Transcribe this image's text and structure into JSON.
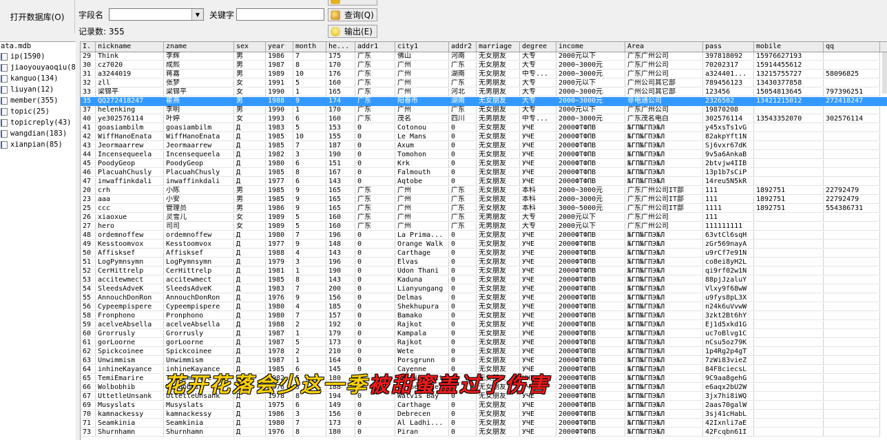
{
  "toolbar": {
    "open_db_label": "打开数据库(O)",
    "field_label": "字段名",
    "field_value": "",
    "keyword_label": "关键字",
    "keyword_value": "",
    "record_count_label": "记录数: 355",
    "query_label": "查询(Q)",
    "export_label": "输出(E)"
  },
  "tree": {
    "root": "ata.mdb",
    "items": [
      "ip(1590)",
      "jiaoyouyaoqiu(8)",
      "kanguo(134)",
      "liuyan(12)",
      "member(355)",
      "topic(25)",
      "topicreply(43)",
      "wangdian(183)",
      "xianpian(85)"
    ]
  },
  "grid": {
    "columns": [
      "I.",
      "nickname",
      "zname",
      "sex",
      "year",
      "month",
      "he...",
      "addr1",
      "city1",
      "addr2",
      "marriage",
      "degree",
      "income",
      "Area",
      "pass",
      "mobile",
      "qq"
    ],
    "selected_row": 6,
    "rows": [
      [
        "29",
        "Think",
        "李辉",
        "男",
        "1986",
        "7",
        "175",
        "广东",
        "佛山",
        "河南",
        "无女朋友",
        "大专",
        "2000元以下",
        "广东广州公司",
        "397818092",
        "15976627193",
        ""
      ],
      [
        "30",
        "cz7020",
        "成熙",
        "男",
        "1987",
        "8",
        "170",
        "广东",
        "广州",
        "广东",
        "无女朋友",
        "大专",
        "2000~3000元",
        "广东广州公司",
        "70202317",
        "15914455612",
        ""
      ],
      [
        "31",
        "a3244019",
        "蒋嘉",
        "男",
        "1989",
        "10",
        "176",
        "广东",
        "广州",
        "湖南",
        "无女朋友",
        "中专...",
        "2000~3000元",
        "广东广州公司",
        "a324401...",
        "13215755727",
        "58096825"
      ],
      [
        "32",
        "zll",
        "张梦",
        "女",
        "1991",
        "5",
        "160",
        "广东",
        "广州",
        "广东",
        "无男朋友",
        "大专",
        "2000元以下",
        "广州公司其它部",
        "789456123",
        "13430377858",
        ""
      ],
      [
        "33",
        "梁锦平",
        "梁锦平",
        "女",
        "1990",
        "1",
        "165",
        "广东",
        "广州",
        "河北",
        "无男朋友",
        "大专",
        "2000~3000元",
        "广州公司其它部",
        "123456",
        "15054813645",
        "797396251"
      ],
      [
        "35",
        "QQ272418247",
        "瞿燕",
        "男",
        "1988",
        "9",
        "174",
        "广东",
        "阳春市",
        "湖南",
        "无女朋友",
        "大专",
        "2000~3000元",
        "非电通公司",
        "2326502",
        "13421215012",
        "272418247"
      ],
      [
        "37",
        "helenking",
        "李明",
        "男",
        "1990",
        "1",
        "170",
        "广东",
        "广州",
        "广东",
        "无女朋友",
        "大专",
        "2000元以下",
        "广东广州公司",
        "19870208",
        "",
        ""
      ],
      [
        "40",
        "ye302576114",
        "叶婷",
        "女",
        "1993",
        "6",
        "160",
        "广东",
        "茂名",
        "四川",
        "无男朋友",
        "中专...",
        "2000~3000元",
        "广东茂名电白",
        "302576114",
        "13543352070",
        "302576114"
      ],
      [
        "41",
        "goasiambilm",
        "goasiambilm",
        "Д",
        "1983",
        "5",
        "153",
        "0",
        "Cotonou",
        "0",
        "无女朋友",
        "УЧЁ",
        "2000ФТФПВ",
        "№ГП№ГПЭ№Л",
        "y45xsTs1vG",
        "",
        ""
      ],
      [
        "42",
        "WiffHanoEnata",
        "WiffHanoEnata",
        "Д",
        "1985",
        "10",
        "155",
        "0",
        "Le Mans",
        "0",
        "无女朋友",
        "УЧЁ",
        "2000ФТФПВ",
        "№ГП№ГПЭ№Л",
        "82akpYft1N",
        "",
        ""
      ],
      [
        "43",
        "Jeormaarrew",
        "Jeormaarrew",
        "Д",
        "1985",
        "7",
        "187",
        "0",
        "Axum",
        "0",
        "无女朋友",
        "УЧЁ",
        "2000ФТФПВ",
        "№ГП№ГПЭ№Л",
        "Sj6vxr67dK",
        "",
        ""
      ],
      [
        "44",
        "Incensequeela",
        "Incensequeela",
        "Д",
        "1982",
        "3",
        "190",
        "0",
        "Tomohon",
        "0",
        "无女朋友",
        "УЧЁ",
        "2000ФТФПВ",
        "№ГП№ГПЭ№Л",
        "9v5a6AnkaB",
        "",
        ""
      ],
      [
        "45",
        "PoodyGeop",
        "PoodyGeop",
        "Д",
        "1980",
        "6",
        "151",
        "0",
        "Krk",
        "0",
        "无女朋友",
        "УЧЁ",
        "2000ФТФПВ",
        "№ГП№ГПЭ№Л",
        "2btvjw4IIB",
        "",
        ""
      ],
      [
        "46",
        "PlacuahChusly",
        "PlacuahChusly",
        "Д",
        "1985",
        "8",
        "167",
        "0",
        "Falmouth",
        "0",
        "无女朋友",
        "УЧЁ",
        "2000ФТФПВ",
        "№ГП№ГПЭ№Л",
        "13p1b7sCiP",
        "",
        ""
      ],
      [
        "47",
        "inwaffinkdali",
        "inwaffinkdali",
        "Д",
        "1977",
        "6",
        "143",
        "0",
        "Aqtobe",
        "0",
        "无女朋友",
        "УЧЁ",
        "2000ФТФПВ",
        "№ГП№ГПЭ№Л",
        "14reu5N5kR",
        "",
        ""
      ],
      [
        "20",
        "crh",
        "小陈",
        "男",
        "1985",
        "9",
        "165",
        "广东",
        "广州",
        "广东",
        "无女朋友",
        "本科",
        "2000~3000元",
        "广东广州公司IT部",
        "111",
        "1892751",
        "22792479"
      ],
      [
        "23",
        "aaa",
        "小安",
        "男",
        "1985",
        "9",
        "165",
        "广东",
        "广州",
        "广东",
        "无女朋友",
        "本科",
        "2000~3000元",
        "广东广州公司IT部",
        "111",
        "1892751",
        "22792479"
      ],
      [
        "25",
        "ccc",
        "管理员",
        "男",
        "1986",
        "9",
        "165",
        "广东",
        "广州",
        "广东",
        "无女朋友",
        "本科",
        "3000~5000元",
        "广东广州公司IT部",
        "1111",
        "1892751",
        "554386731"
      ],
      [
        "26",
        "xiaoxue",
        "灵雪儿",
        "女",
        "1989",
        "5",
        "160",
        "广东",
        "广州",
        "广东",
        "无男朋友",
        "大专",
        "2000元以下",
        "广东广州公司",
        "111",
        "",
        ""
      ],
      [
        "27",
        "hero",
        "司司",
        "女",
        "1989",
        "5",
        "160",
        "广东",
        "广州",
        "广东",
        "无男朋友",
        "大专",
        "2000元以下",
        "广东广州公司",
        "111111111",
        "",
        ""
      ],
      [
        "48",
        "ordemnoffew",
        "ordemnoffew",
        "Д",
        "1980",
        "7",
        "196",
        "0",
        "La Prima...",
        "0",
        "无女朋友",
        "УЧЁ",
        "2000ФТФПВ",
        "№ГП№ГПЭ№Л",
        "63vtCl6sqH",
        "",
        ""
      ],
      [
        "49",
        "Kesstoomvox",
        "Kesstoomvox",
        "Д",
        "1977",
        "9",
        "148",
        "0",
        "Orange Walk",
        "0",
        "无女朋友",
        "УЧЁ",
        "2000ФТФПВ",
        "№ГП№ГПЭ№Л",
        "zGr569nayA",
        "",
        ""
      ],
      [
        "50",
        "Affisksef",
        "Affisksef",
        "Д",
        "1988",
        "4",
        "143",
        "0",
        "Carthage",
        "0",
        "无女朋友",
        "УЧЁ",
        "2000ФТФПВ",
        "№ГП№ГПЭ№Л",
        "u9rCf7e91N",
        "",
        ""
      ],
      [
        "51",
        "LogPymnsymn",
        "LogPymnsymn",
        "Д",
        "1979",
        "3",
        "196",
        "0",
        "Elvas",
        "0",
        "无女朋友",
        "УЧЁ",
        "2000ФТФПВ",
        "№ГП№ГПЭ№Л",
        "co8ei8yH2L",
        "",
        ""
      ],
      [
        "52",
        "CerHittrelp",
        "CerHittrelp",
        "Д",
        "1981",
        "1",
        "190",
        "0",
        "Udon Thani",
        "0",
        "无女朋友",
        "УЧЁ",
        "2000ФТФПВ",
        "№ГП№ГПЭ№Л",
        "qi9rf02w1N",
        "",
        ""
      ],
      [
        "53",
        "accitewmect",
        "accitewmect",
        "Д",
        "1985",
        "8",
        "143",
        "0",
        "Kaduna",
        "0",
        "无女朋友",
        "УЧЁ",
        "2000ФТФПВ",
        "№ГП№ГПЭ№Л",
        "88pjJzaluY",
        "",
        ""
      ],
      [
        "54",
        "SleedsAdveK",
        "SleedsAdveK",
        "Д",
        "1983",
        "7",
        "200",
        "0",
        "Lianyungang",
        "0",
        "无女朋友",
        "УЧЁ",
        "2000ФТФПВ",
        "№ГП№ГПЭ№Л",
        "Vlxy9f68wW",
        "",
        ""
      ],
      [
        "55",
        "AnnouchDonRon",
        "AnnouchDonRon",
        "Д",
        "1976",
        "9",
        "156",
        "0",
        "Delmas",
        "0",
        "无女朋友",
        "УЧЁ",
        "2000ФТФПВ",
        "№ГП№ГПЭ№Л",
        "u9fys8pL3X",
        "",
        ""
      ],
      [
        "56",
        "Cypeempispere",
        "Cypeempispere",
        "Д",
        "1980",
        "4",
        "185",
        "0",
        "Shekhupura",
        "0",
        "无女朋友",
        "УЧЁ",
        "2000ФТФПВ",
        "№ГП№ГПЭ№Л",
        "n24k6uVvwW",
        "",
        ""
      ],
      [
        "58",
        "Fronphono",
        "Pronphono",
        "Д",
        "1980",
        "7",
        "157",
        "0",
        "Bamako",
        "0",
        "无女朋友",
        "УЧЁ",
        "2000ФТФПВ",
        "№ГП№ГПЭ№Л",
        "3zkt2Bt6hY",
        "",
        ""
      ],
      [
        "59",
        "acelveAbsella",
        "acelveAbsella",
        "Д",
        "1988",
        "2",
        "192",
        "0",
        "Rajkot",
        "0",
        "无女朋友",
        "УЧЁ",
        "2000ФТФПВ",
        "№ГП№ГПЭ№Л",
        "Ej1d5xkd1G",
        "",
        ""
      ],
      [
        "60",
        "Grorrusly",
        "Grorrusly",
        "Д",
        "1987",
        "1",
        "179",
        "0",
        "Kampala",
        "0",
        "无女朋友",
        "УЧЁ",
        "2000ФТФПВ",
        "№ГП№ГПЭ№Л",
        "uc7oBlvg1C",
        "",
        ""
      ],
      [
        "61",
        "gorLoorne",
        "gorLoorne",
        "Д",
        "1987",
        "5",
        "173",
        "0",
        "Rajkot",
        "0",
        "无女朋友",
        "УЧЁ",
        "2000ФТФПВ",
        "№ГП№ГПЭ№Л",
        "nCsu5oz79K",
        "",
        ""
      ],
      [
        "62",
        "Spickcoinee",
        "Spickcoinee",
        "Д",
        "1978",
        "2",
        "210",
        "0",
        "Wete",
        "0",
        "无女朋友",
        "УЧЁ",
        "2000ФТФПВ",
        "№ГП№ГПЭ№Л",
        "1p4Rg2p4gT",
        "",
        ""
      ],
      [
        "63",
        "Unwimmism",
        "Unwimmism",
        "Д",
        "1987",
        "1",
        "164",
        "0",
        "Porsgrunn",
        "0",
        "无女朋友",
        "УЧЁ",
        "2000ФТФПВ",
        "№ГП№ГПЭ№Л",
        "7zWi83vieZ",
        "",
        ""
      ],
      [
        "64",
        "inhineKayance",
        "inhineKayance",
        "Д",
        "1985",
        "6",
        "145",
        "0",
        "Cayenne",
        "0",
        "无女朋友",
        "УЧЁ",
        "2000ФТФПВ",
        "№ГП№ГПЭ№Л",
        "84F8ciecsL",
        "",
        ""
      ],
      [
        "65",
        "TemiEmarire",
        "TemiEmarire",
        "Д",
        "1982",
        "5",
        "180",
        "0",
        "Ga District",
        "0",
        "无女朋友",
        "УЧЁ",
        "2000ФТФПВ",
        "№ГП№ГПЭ№Л",
        "9C9aa8gehG",
        "",
        ""
      ],
      [
        "66",
        "Wolbobhib",
        "Wolbobhib",
        "Д",
        "1976",
        "5",
        "188",
        "0",
        "Hesperange",
        "0",
        "无女朋友",
        "УЧЁ",
        "2000ФТФПВ",
        "№ГП№ГПЭ№Л",
        "e6aqx2bU2W",
        "",
        ""
      ],
      [
        "67",
        "UttetleUnsank",
        "UttetleUnsank",
        "Д",
        "1978",
        "8",
        "194",
        "0",
        "Walvis Bay",
        "0",
        "无女朋友",
        "УЧЁ",
        "2000ФТФПВ",
        "№ГП№ГПЭ№Л",
        "3jx7hi8iWQ",
        "",
        ""
      ],
      [
        "69",
        "Musyslats",
        "Musyslats",
        "Д",
        "1975",
        "6",
        "149",
        "0",
        "Carthage",
        "0",
        "无女朋友",
        "УЧЁ",
        "2000ФТФПВ",
        "№ГП№ГПЭ№Л",
        "2aas70galW",
        "",
        ""
      ],
      [
        "70",
        "kamnackessy",
        "kamnackessy",
        "Д",
        "1986",
        "3",
        "156",
        "0",
        "Debrecen",
        "0",
        "无女朋友",
        "УЧЁ",
        "2000ФТФПВ",
        "№ГП№ГПЭ№Л",
        "3sj41cHabL",
        "",
        ""
      ],
      [
        "71",
        "Seamkinia",
        "Seamkinia",
        "Д",
        "1980",
        "7",
        "173",
        "0",
        "Al Ladhi...",
        "0",
        "无女朋友",
        "УЧЁ",
        "2000ФТФПВ",
        "№ГП№ГПЭ№Л",
        "42Ixnli7aE",
        "",
        ""
      ],
      [
        "73",
        "Shurnhamn",
        "Shurnhamn",
        "Д",
        "1976",
        "8",
        "180",
        "0",
        "Piran",
        "0",
        "无女朋友",
        "УЧЁ",
        "2000ФТФПВ",
        "№ГП№ГПЭ№Л",
        "42Fcqbn61I",
        "",
        ""
      ]
    ]
  },
  "watermark": {
    "part1": "花开花落会少这一季",
    "part2": "被甜蜜盖过了伤害"
  },
  "colors": {
    "selection": "#3399ff",
    "watermark_yellow": "#ffd200",
    "watermark_red": "#e81c1c"
  }
}
